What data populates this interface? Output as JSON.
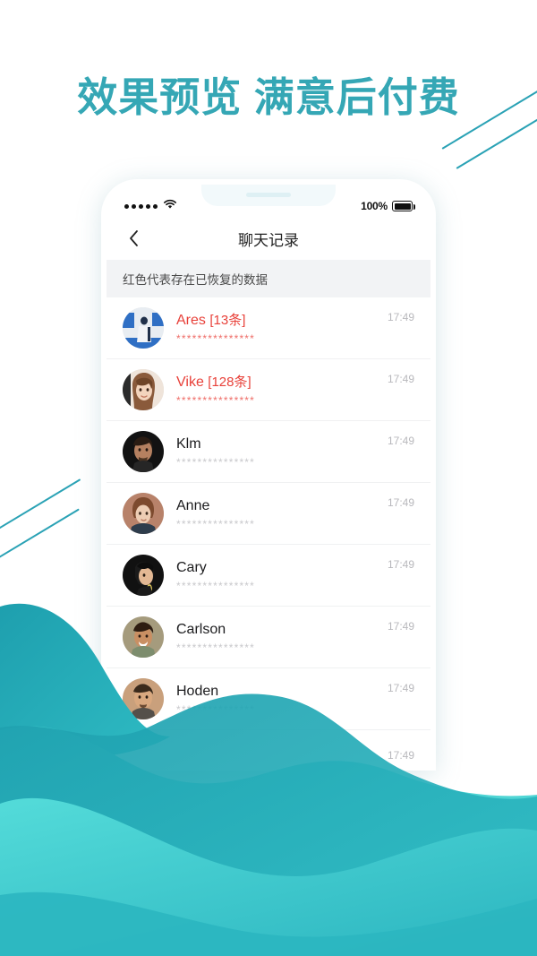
{
  "headline": "效果预览 满意后付费",
  "theme": {
    "accent": "#35a7b5",
    "wave_dark": "#1c9fb0",
    "wave_mid": "#35bdc6",
    "wave_light": "#4fdbd9",
    "recovered_red": "#e8413a",
    "notice_bg": "#f2f3f5"
  },
  "phone": {
    "statusbar": {
      "signal_icon": "signal-dots-icon",
      "wifi_icon": "wifi-icon",
      "battery_percent": "100%",
      "battery_icon": "battery-full-icon"
    },
    "navbar": {
      "back_icon": "chevron-left-icon",
      "title": "聊天记录"
    },
    "notice": "红色代表存在已恢复的数据",
    "chat_rows": [
      {
        "name": "Ares",
        "count": "[13条]",
        "preview": "***************",
        "time": "17:49",
        "recovered": true,
        "avatar": "avatar-ares"
      },
      {
        "name": "Vike",
        "count": "[128条]",
        "preview": "***************",
        "time": "17:49",
        "recovered": true,
        "avatar": "avatar-vike"
      },
      {
        "name": "Klm",
        "count": "",
        "preview": "***************",
        "time": "17:49",
        "recovered": false,
        "avatar": "avatar-klm"
      },
      {
        "name": "Anne",
        "count": "",
        "preview": "***************",
        "time": "17:49",
        "recovered": false,
        "avatar": "avatar-anne"
      },
      {
        "name": "Cary",
        "count": "",
        "preview": "***************",
        "time": "17:49",
        "recovered": false,
        "avatar": "avatar-cary"
      },
      {
        "name": "Carlson",
        "count": "",
        "preview": "***************",
        "time": "17:49",
        "recovered": false,
        "avatar": "avatar-carlson"
      },
      {
        "name": "Hoden",
        "count": "",
        "preview": "***************",
        "time": "17:49",
        "recovered": false,
        "avatar": "avatar-hoden"
      },
      {
        "name": "",
        "count": "",
        "preview": "",
        "time": "17:49",
        "recovered": false,
        "avatar": ""
      }
    ]
  }
}
